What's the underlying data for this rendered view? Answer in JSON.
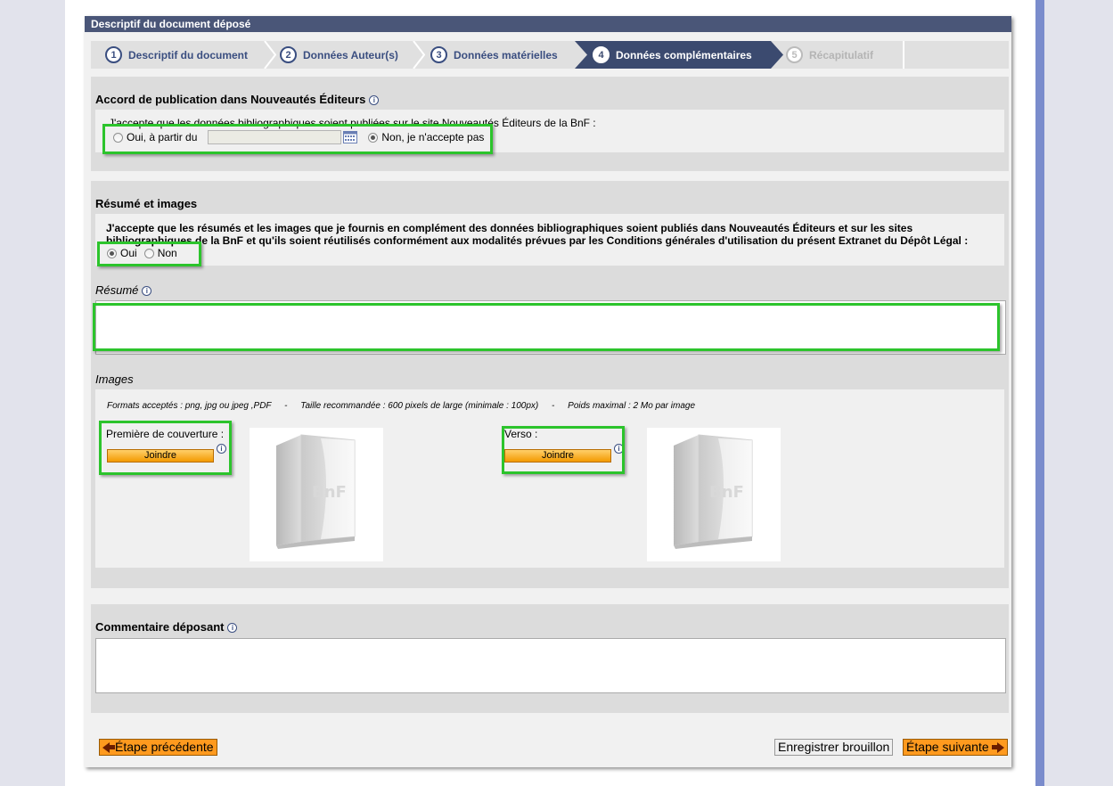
{
  "panel": {
    "title": "Descriptif du document déposé"
  },
  "steps": [
    {
      "num": "1",
      "label": "Descriptif du document",
      "state": "done"
    },
    {
      "num": "2",
      "label": "Données Auteur(s)",
      "state": "done"
    },
    {
      "num": "3",
      "label": "Données matérielles",
      "state": "done"
    },
    {
      "num": "4",
      "label": "Données complémentaires",
      "state": "active"
    },
    {
      "num": "5",
      "label": "Récapitulatif",
      "state": "disabled"
    }
  ],
  "accord": {
    "title": "Accord de publication dans Nouveautés Éditeurs",
    "statement": "J'accepte que les données bibliographiques soient publiées sur le site Nouveautés Éditeurs de la BnF :",
    "oui_label": "Oui, à partir du",
    "date_value": "",
    "non_label": "Non, je n'accepte pas",
    "selected": "non"
  },
  "resume_images": {
    "title": "Résumé et images",
    "statement_line1": "J'accepte que les résumés et les images que je fournis en complément des données bibliographiques soient publiés dans Nouveautés Éditeurs et sur les sites",
    "statement_line2": "bibliographiques de la BnF et qu'ils soient réutilisés conformément aux modalités prévues par les Conditions générales d'utilisation du présent Extranet du Dépôt Légal :",
    "oui_label": "Oui",
    "non_label": "Non",
    "selected": "oui"
  },
  "resume": {
    "label": "Résumé",
    "value": ""
  },
  "images": {
    "label": "Images",
    "formats": "Formats acceptés : png, jpg ou jpeg ,PDF",
    "sep": "-",
    "taille": "Taille recommandée : 600 pixels de large (minimale : 100px)",
    "poids": "Poids maximal : 2 Mo par image",
    "front_label": "Première de couverture :",
    "back_label": "Verso :",
    "join_label": "Joindre",
    "placeholder_text": "BnF"
  },
  "commentaire": {
    "label": "Commentaire déposant",
    "value": ""
  },
  "footer": {
    "prev_label": "Étape précédente",
    "save_label": "Enregistrer brouillon",
    "next_label": "Étape suivante"
  },
  "colors": {
    "header_bg": "#4a5678",
    "step_active_bg": "#3b4a6f",
    "highlight_green": "#2cc42c",
    "nav_orange": "#ff9a1e",
    "rail_blue": "#7a8ccc"
  }
}
